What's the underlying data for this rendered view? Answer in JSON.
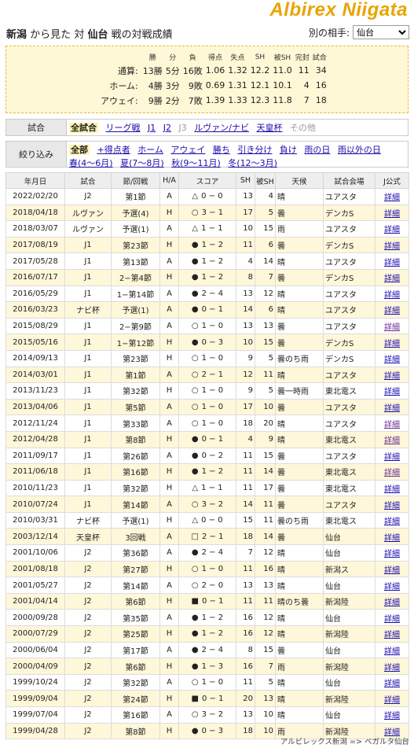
{
  "brand": "Albirex Niigata",
  "title": {
    "team": "新潟",
    "seen_from": "から見た",
    "versus": "対",
    "opponent": "仙台",
    "suffix": "戦の対戦成績"
  },
  "opponent_select": {
    "label": "別の相手:",
    "value": "仙台"
  },
  "summary": {
    "headers": [
      "勝",
      "分",
      "負",
      "得点",
      "失点",
      "SH",
      "被SH",
      "完封",
      "試合"
    ],
    "rows": [
      {
        "label": "通算:",
        "w": "13勝",
        "d": "5分",
        "l": "16敗",
        "gf": "1.06",
        "ga": "1.32",
        "sh": "12.2",
        "osh": "11.0",
        "cs": "11",
        "games": "34"
      },
      {
        "label": "ホーム:",
        "w": "4勝",
        "d": "3分",
        "l": "9敗",
        "gf": "0.69",
        "ga": "1.31",
        "sh": "12.1",
        "osh": "10.1",
        "cs": "4",
        "games": "16"
      },
      {
        "label": "アウェイ:",
        "w": "9勝",
        "d": "2分",
        "l": "7敗",
        "gf": "1.39",
        "ga": "1.33",
        "sh": "12.3",
        "osh": "11.8",
        "cs": "7",
        "games": "18"
      }
    ]
  },
  "filter_games": {
    "label": "試合",
    "selected": "全試合",
    "links": [
      "リーグ戦",
      "J1",
      "J2"
    ],
    "disabled_1": "J3",
    "links2": [
      "ルヴァン/ナビ",
      "天皇杯"
    ],
    "disabled_2": "その他"
  },
  "filter_narrow": {
    "label": "絞り込み",
    "selected": "全部",
    "links": [
      "+得点者",
      "ホーム",
      "アウェイ",
      "勝ち",
      "引き分け",
      "負け",
      "雨の日",
      "雨以外の日",
      "春(4〜6月)",
      "夏(7〜8月)",
      "秋(9〜11月)",
      "冬(12〜3月)"
    ]
  },
  "table": {
    "headers": [
      "年月日",
      "試合",
      "節/回戦",
      "H/A",
      "スコア",
      "SH",
      "被SH",
      "天候",
      "試合会場",
      "J公式"
    ],
    "rows": [
      {
        "date": "2022/02/20",
        "comp": "J2",
        "round": "第1節",
        "ha": "A",
        "res": "△",
        "score": "0 − 0",
        "sh": "13",
        "osh": "4",
        "weather": "晴",
        "venue": "ユアスタ",
        "link": "詳細"
      },
      {
        "date": "2018/04/18",
        "comp": "ルヴァン",
        "round": "予選(4)",
        "ha": "H",
        "res": "○",
        "score": "3 − 1",
        "sh": "17",
        "osh": "5",
        "weather": "曇",
        "venue": "デンカS",
        "link": "詳細"
      },
      {
        "date": "2018/03/07",
        "comp": "ルヴァン",
        "round": "予選(1)",
        "ha": "A",
        "res": "△",
        "score": "1 − 1",
        "sh": "10",
        "osh": "15",
        "weather": "雨",
        "venue": "ユアスタ",
        "link": "詳細"
      },
      {
        "date": "2017/08/19",
        "comp": "J1",
        "round": "第23節",
        "ha": "H",
        "res": "●",
        "score": "1 − 2",
        "sh": "11",
        "osh": "6",
        "weather": "曇",
        "venue": "デンカS",
        "link": "詳細"
      },
      {
        "date": "2017/05/28",
        "comp": "J1",
        "round": "第13節",
        "ha": "A",
        "res": "●",
        "score": "1 − 2",
        "sh": "4",
        "osh": "14",
        "weather": "晴",
        "venue": "ユアスタ",
        "link": "詳細"
      },
      {
        "date": "2016/07/17",
        "comp": "J1",
        "round": "2−第4節",
        "ha": "H",
        "res": "●",
        "score": "1 − 2",
        "sh": "8",
        "osh": "7",
        "weather": "曇",
        "venue": "デンカS",
        "link": "詳細"
      },
      {
        "date": "2016/05/29",
        "comp": "J1",
        "round": "1−第14節",
        "ha": "A",
        "res": "●",
        "score": "2 − 4",
        "sh": "13",
        "osh": "12",
        "weather": "晴",
        "venue": "ユアスタ",
        "link": "詳細"
      },
      {
        "date": "2016/03/23",
        "comp": "ナビ杯",
        "round": "予選(1)",
        "ha": "A",
        "res": "●",
        "score": "0 − 1",
        "sh": "14",
        "osh": "6",
        "weather": "晴",
        "venue": "ユアスタ",
        "link": "詳細"
      },
      {
        "date": "2015/08/29",
        "comp": "J1",
        "round": "2−第9節",
        "ha": "A",
        "res": "○",
        "score": "1 − 0",
        "sh": "13",
        "osh": "13",
        "weather": "曇",
        "venue": "ユアスタ",
        "link": "詳細"
      },
      {
        "date": "2015/05/16",
        "comp": "J1",
        "round": "1−第12節",
        "ha": "H",
        "res": "●",
        "score": "0 − 3",
        "sh": "10",
        "osh": "15",
        "weather": "曇",
        "venue": "デンカS",
        "link": "詳細"
      },
      {
        "date": "2014/09/13",
        "comp": "J1",
        "round": "第23節",
        "ha": "H",
        "res": "○",
        "score": "1 − 0",
        "sh": "9",
        "osh": "5",
        "weather": "曇のち雨",
        "venue": "デンカS",
        "link": "詳細"
      },
      {
        "date": "2014/03/01",
        "comp": "J1",
        "round": "第1節",
        "ha": "A",
        "res": "○",
        "score": "2 − 1",
        "sh": "12",
        "osh": "11",
        "weather": "晴",
        "venue": "ユアスタ",
        "link": "詳細"
      },
      {
        "date": "2013/11/23",
        "comp": "J1",
        "round": "第32節",
        "ha": "H",
        "res": "○",
        "score": "1 − 0",
        "sh": "9",
        "osh": "5",
        "weather": "曇一時雨",
        "venue": "東北電ス",
        "link": "詳細"
      },
      {
        "date": "2013/04/06",
        "comp": "J1",
        "round": "第5節",
        "ha": "A",
        "res": "○",
        "score": "1 − 0",
        "sh": "17",
        "osh": "10",
        "weather": "曇",
        "venue": "ユアスタ",
        "link": "詳細"
      },
      {
        "date": "2012/11/24",
        "comp": "J1",
        "round": "第33節",
        "ha": "A",
        "res": "○",
        "score": "1 − 0",
        "sh": "18",
        "osh": "20",
        "weather": "晴",
        "venue": "ユアスタ",
        "link": "詳細"
      },
      {
        "date": "2012/04/28",
        "comp": "J1",
        "round": "第8節",
        "ha": "H",
        "res": "●",
        "score": "0 − 1",
        "sh": "4",
        "osh": "9",
        "weather": "晴",
        "venue": "東北電ス",
        "link": "詳細"
      },
      {
        "date": "2011/09/17",
        "comp": "J1",
        "round": "第26節",
        "ha": "A",
        "res": "●",
        "score": "0 − 2",
        "sh": "11",
        "osh": "15",
        "weather": "曇",
        "venue": "ユアスタ",
        "link": "詳細"
      },
      {
        "date": "2011/06/18",
        "comp": "J1",
        "round": "第16節",
        "ha": "H",
        "res": "●",
        "score": "1 − 2",
        "sh": "11",
        "osh": "14",
        "weather": "曇",
        "venue": "東北電ス",
        "link": "詳細"
      },
      {
        "date": "2010/11/23",
        "comp": "J1",
        "round": "第32節",
        "ha": "H",
        "res": "△",
        "score": "1 − 1",
        "sh": "11",
        "osh": "17",
        "weather": "曇",
        "venue": "東北電ス",
        "link": "詳細"
      },
      {
        "date": "2010/07/24",
        "comp": "J1",
        "round": "第14節",
        "ha": "A",
        "res": "○",
        "score": "3 − 2",
        "sh": "14",
        "osh": "11",
        "weather": "曇",
        "venue": "ユアスタ",
        "link": "詳細"
      },
      {
        "date": "2010/03/31",
        "comp": "ナビ杯",
        "round": "予選(1)",
        "ha": "H",
        "res": "△",
        "score": "0 − 0",
        "sh": "15",
        "osh": "11",
        "weather": "曇のち雨",
        "venue": "東北電ス",
        "link": "詳細"
      },
      {
        "date": "2003/12/14",
        "comp": "天皇杯",
        "round": "3回戦",
        "ha": "A",
        "res": "□",
        "score": "2 − 1",
        "sh": "18",
        "osh": "14",
        "weather": "曇",
        "venue": "仙台",
        "link": "詳細"
      },
      {
        "date": "2001/10/06",
        "comp": "J2",
        "round": "第36節",
        "ha": "A",
        "res": "●",
        "score": "2 − 4",
        "sh": "7",
        "osh": "12",
        "weather": "晴",
        "venue": "仙台",
        "link": "詳細"
      },
      {
        "date": "2001/08/18",
        "comp": "J2",
        "round": "第27節",
        "ha": "H",
        "res": "○",
        "score": "1 − 0",
        "sh": "11",
        "osh": "16",
        "weather": "晴",
        "venue": "新潟ス",
        "link": "詳細"
      },
      {
        "date": "2001/05/27",
        "comp": "J2",
        "round": "第14節",
        "ha": "A",
        "res": "○",
        "score": "2 − 0",
        "sh": "13",
        "osh": "13",
        "weather": "晴",
        "venue": "仙台",
        "link": "詳細"
      },
      {
        "date": "2001/04/14",
        "comp": "J2",
        "round": "第6節",
        "ha": "H",
        "res": "■",
        "score": "0 − 1",
        "sh": "11",
        "osh": "11",
        "weather": "晴のち曇",
        "venue": "新潟陸",
        "link": "詳細"
      },
      {
        "date": "2000/09/28",
        "comp": "J2",
        "round": "第35節",
        "ha": "A",
        "res": "●",
        "score": "1 − 2",
        "sh": "16",
        "osh": "12",
        "weather": "晴",
        "venue": "仙台",
        "link": "詳細"
      },
      {
        "date": "2000/07/29",
        "comp": "J2",
        "round": "第25節",
        "ha": "H",
        "res": "●",
        "score": "1 − 2",
        "sh": "16",
        "osh": "12",
        "weather": "晴",
        "venue": "新潟陸",
        "link": "詳細"
      },
      {
        "date": "2000/06/04",
        "comp": "J2",
        "round": "第17節",
        "ha": "A",
        "res": "●",
        "score": "2 − 4",
        "sh": "8",
        "osh": "15",
        "weather": "曇",
        "venue": "仙台",
        "link": "詳細"
      },
      {
        "date": "2000/04/09",
        "comp": "J2",
        "round": "第6節",
        "ha": "H",
        "res": "●",
        "score": "1 − 3",
        "sh": "16",
        "osh": "7",
        "weather": "雨",
        "venue": "新潟陸",
        "link": "詳細"
      },
      {
        "date": "1999/10/24",
        "comp": "J2",
        "round": "第32節",
        "ha": "A",
        "res": "○",
        "score": "1 − 0",
        "sh": "11",
        "osh": "5",
        "weather": "晴",
        "venue": "仙台",
        "link": "詳細"
      },
      {
        "date": "1999/09/04",
        "comp": "J2",
        "round": "第24節",
        "ha": "H",
        "res": "■",
        "score": "0 − 1",
        "sh": "20",
        "osh": "13",
        "weather": "晴",
        "venue": "新潟陸",
        "link": "詳細"
      },
      {
        "date": "1999/07/04",
        "comp": "J2",
        "round": "第16節",
        "ha": "A",
        "res": "○",
        "score": "3 − 2",
        "sh": "13",
        "osh": "10",
        "weather": "晴",
        "venue": "仙台",
        "link": "詳細"
      },
      {
        "date": "1999/04/28",
        "comp": "J2",
        "round": "第8節",
        "ha": "H",
        "res": "●",
        "score": "0 − 3",
        "sh": "18",
        "osh": "10",
        "weather": "雨",
        "venue": "新潟陸",
        "link": "詳細"
      }
    ]
  },
  "footer": "アルビレックス新潟 => ベガルタ仙台",
  "colors": {
    "brand": "#e8a400",
    "summary_bg": "#fff8d6",
    "row_alt": "#fff7d9",
    "link": "#1a0dab"
  }
}
